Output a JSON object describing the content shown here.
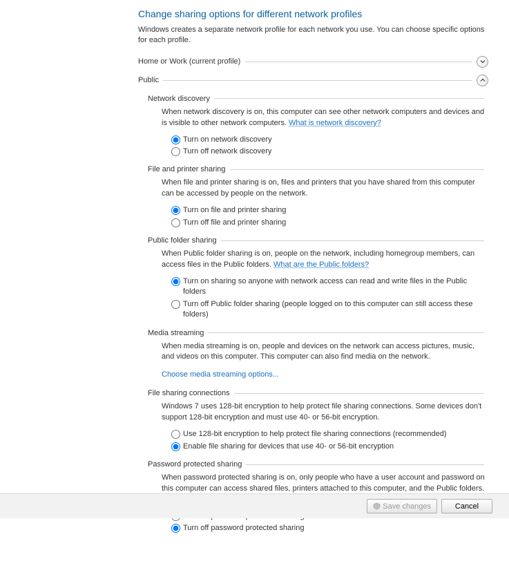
{
  "title": "Change sharing options for different network profiles",
  "description": "Windows creates a separate network profile for each network you use. You can choose specific options for each profile.",
  "profiles": {
    "home": "Home or Work (current profile)",
    "public": "Public"
  },
  "sections": {
    "network_discovery": {
      "title": "Network discovery",
      "desc_prefix": "When network discovery is on, this computer can see other network computers and devices and is visible to other network computers. ",
      "link": "What is network discovery?",
      "opt_on": "Turn on network discovery",
      "opt_off": "Turn off network discovery"
    },
    "file_printer": {
      "title": "File and printer sharing",
      "desc": "When file and printer sharing is on, files and printers that you have shared from this computer can be accessed by people on the network.",
      "opt_on": "Turn on file and printer sharing",
      "opt_off": "Turn off file and printer sharing"
    },
    "public_folder": {
      "title": "Public folder sharing",
      "desc_prefix": "When Public folder sharing is on, people on the network, including homegroup members, can access files in the Public folders. ",
      "link": "What are the Public folders?",
      "opt_on": "Turn on sharing so anyone with network access can read and write files in the Public folders",
      "opt_off": "Turn off Public folder sharing (people logged on to this computer can still access these folders)"
    },
    "media": {
      "title": "Media streaming",
      "desc": "When media streaming is on, people and devices on the network can access pictures, music, and videos on this computer. This computer can also find media on the network.",
      "link": "Choose media streaming options..."
    },
    "encryption": {
      "title": "File sharing connections",
      "desc": "Windows 7 uses 128-bit encryption to help protect file sharing connections. Some devices don't support 128-bit encryption and must use 40- or 56-bit encryption.",
      "opt_128": "Use 128-bit encryption to help protect file sharing connections (recommended)",
      "opt_40": "Enable file sharing for devices that use 40- or 56-bit encryption"
    },
    "password": {
      "title": "Password protected sharing",
      "desc": "When password protected sharing is on, only people who have a user account and password on this computer can access shared files, printers attached to this computer, and the Public folders. To give other people access, you must turn off password protected sharing.",
      "opt_on": "Turn on password protected sharing",
      "opt_off": "Turn off password protected sharing"
    }
  },
  "buttons": {
    "save": "Save changes",
    "cancel": "Cancel"
  },
  "colors": {
    "title": "#0a5f9e",
    "link": "#1a6fc4"
  }
}
